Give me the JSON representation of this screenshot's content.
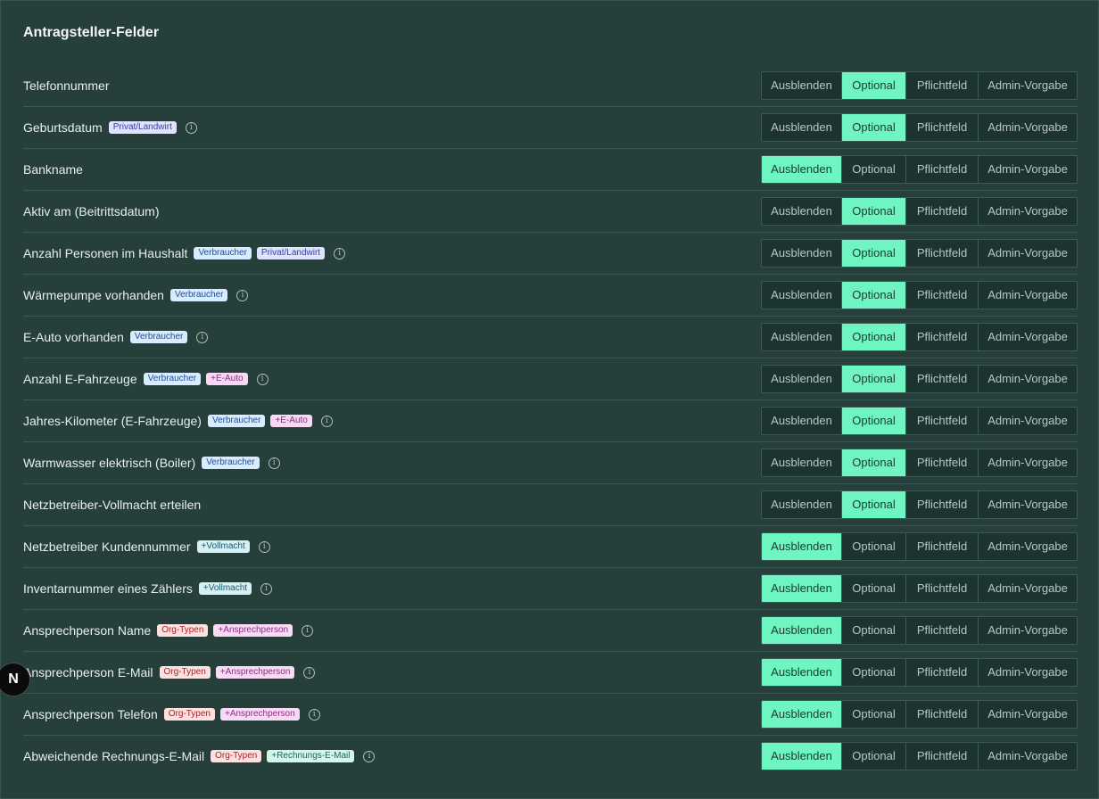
{
  "panel": {
    "title": "Antragsteller-Felder"
  },
  "options": [
    "Ausblenden",
    "Optional",
    "Pflichtfeld",
    "Admin-Vorgabe"
  ],
  "badge_styles": {
    "Privat/Landwirt": {
      "bg": "#dfe3ff",
      "fg": "#3a3f9c"
    },
    "Verbraucher": {
      "bg": "#d8ebff",
      "fg": "#1e4f93"
    },
    "+E-Auto": {
      "bg": "#f8d8f4",
      "fg": "#8c2e84"
    },
    "+Vollmacht": {
      "bg": "#d6f0f6",
      "fg": "#175a69"
    },
    "Org-Typen": {
      "bg": "#fde0e0",
      "fg": "#a52626"
    },
    "+Ansprechperson": {
      "bg": "#f8daf5",
      "fg": "#8c2e84"
    },
    "+Rechnungs-E-Mail": {
      "bg": "#d3f5ea",
      "fg": "#176a55"
    }
  },
  "fields": [
    {
      "label": "Telefonnummer",
      "badges": [],
      "info": false,
      "selected": 1
    },
    {
      "label": "Geburtsdatum",
      "badges": [
        "Privat/Landwirt"
      ],
      "info": true,
      "selected": 1
    },
    {
      "label": "Bankname",
      "badges": [],
      "info": false,
      "selected": 0
    },
    {
      "label": "Aktiv am (Beitrittsdatum)",
      "badges": [],
      "info": false,
      "selected": 1
    },
    {
      "label": "Anzahl Personen im Haushalt",
      "badges": [
        "Verbraucher",
        "Privat/Landwirt"
      ],
      "info": true,
      "selected": 1
    },
    {
      "label": "Wärmepumpe vorhanden",
      "badges": [
        "Verbraucher"
      ],
      "info": true,
      "selected": 1
    },
    {
      "label": "E-Auto vorhanden",
      "badges": [
        "Verbraucher"
      ],
      "info": true,
      "selected": 1
    },
    {
      "label": "Anzahl E-Fahrzeuge",
      "badges": [
        "Verbraucher",
        "+E-Auto"
      ],
      "info": true,
      "selected": 1
    },
    {
      "label": "Jahres-Kilometer (E-Fahrzeuge)",
      "badges": [
        "Verbraucher",
        "+E-Auto"
      ],
      "info": true,
      "selected": 1
    },
    {
      "label": "Warmwasser elektrisch (Boiler)",
      "badges": [
        "Verbraucher"
      ],
      "info": true,
      "selected": 1
    },
    {
      "label": "Netzbetreiber-Vollmacht erteilen",
      "badges": [],
      "info": false,
      "selected": 1
    },
    {
      "label": "Netzbetreiber Kundennummer",
      "badges": [
        "+Vollmacht"
      ],
      "info": true,
      "selected": 0
    },
    {
      "label": "Inventarnummer eines Zählers",
      "badges": [
        "+Vollmacht"
      ],
      "info": true,
      "selected": 0
    },
    {
      "label": "Ansprechperson Name",
      "badges": [
        "Org-Typen",
        "+Ansprechperson"
      ],
      "info": true,
      "selected": 0
    },
    {
      "label": "Ansprechperson E-Mail",
      "badges": [
        "Org-Typen",
        "+Ansprechperson"
      ],
      "info": true,
      "selected": 0
    },
    {
      "label": "Ansprechperson Telefon",
      "badges": [
        "Org-Typen",
        "+Ansprechperson"
      ],
      "info": true,
      "selected": 0
    },
    {
      "label": "Abweichende Rechnungs-E-Mail",
      "badges": [
        "Org-Typen",
        "+Rechnungs-E-Mail"
      ],
      "info": true,
      "selected": 0
    }
  ],
  "next_badge": {
    "glyph": "N",
    "icon": "nextjs-logo-icon"
  }
}
